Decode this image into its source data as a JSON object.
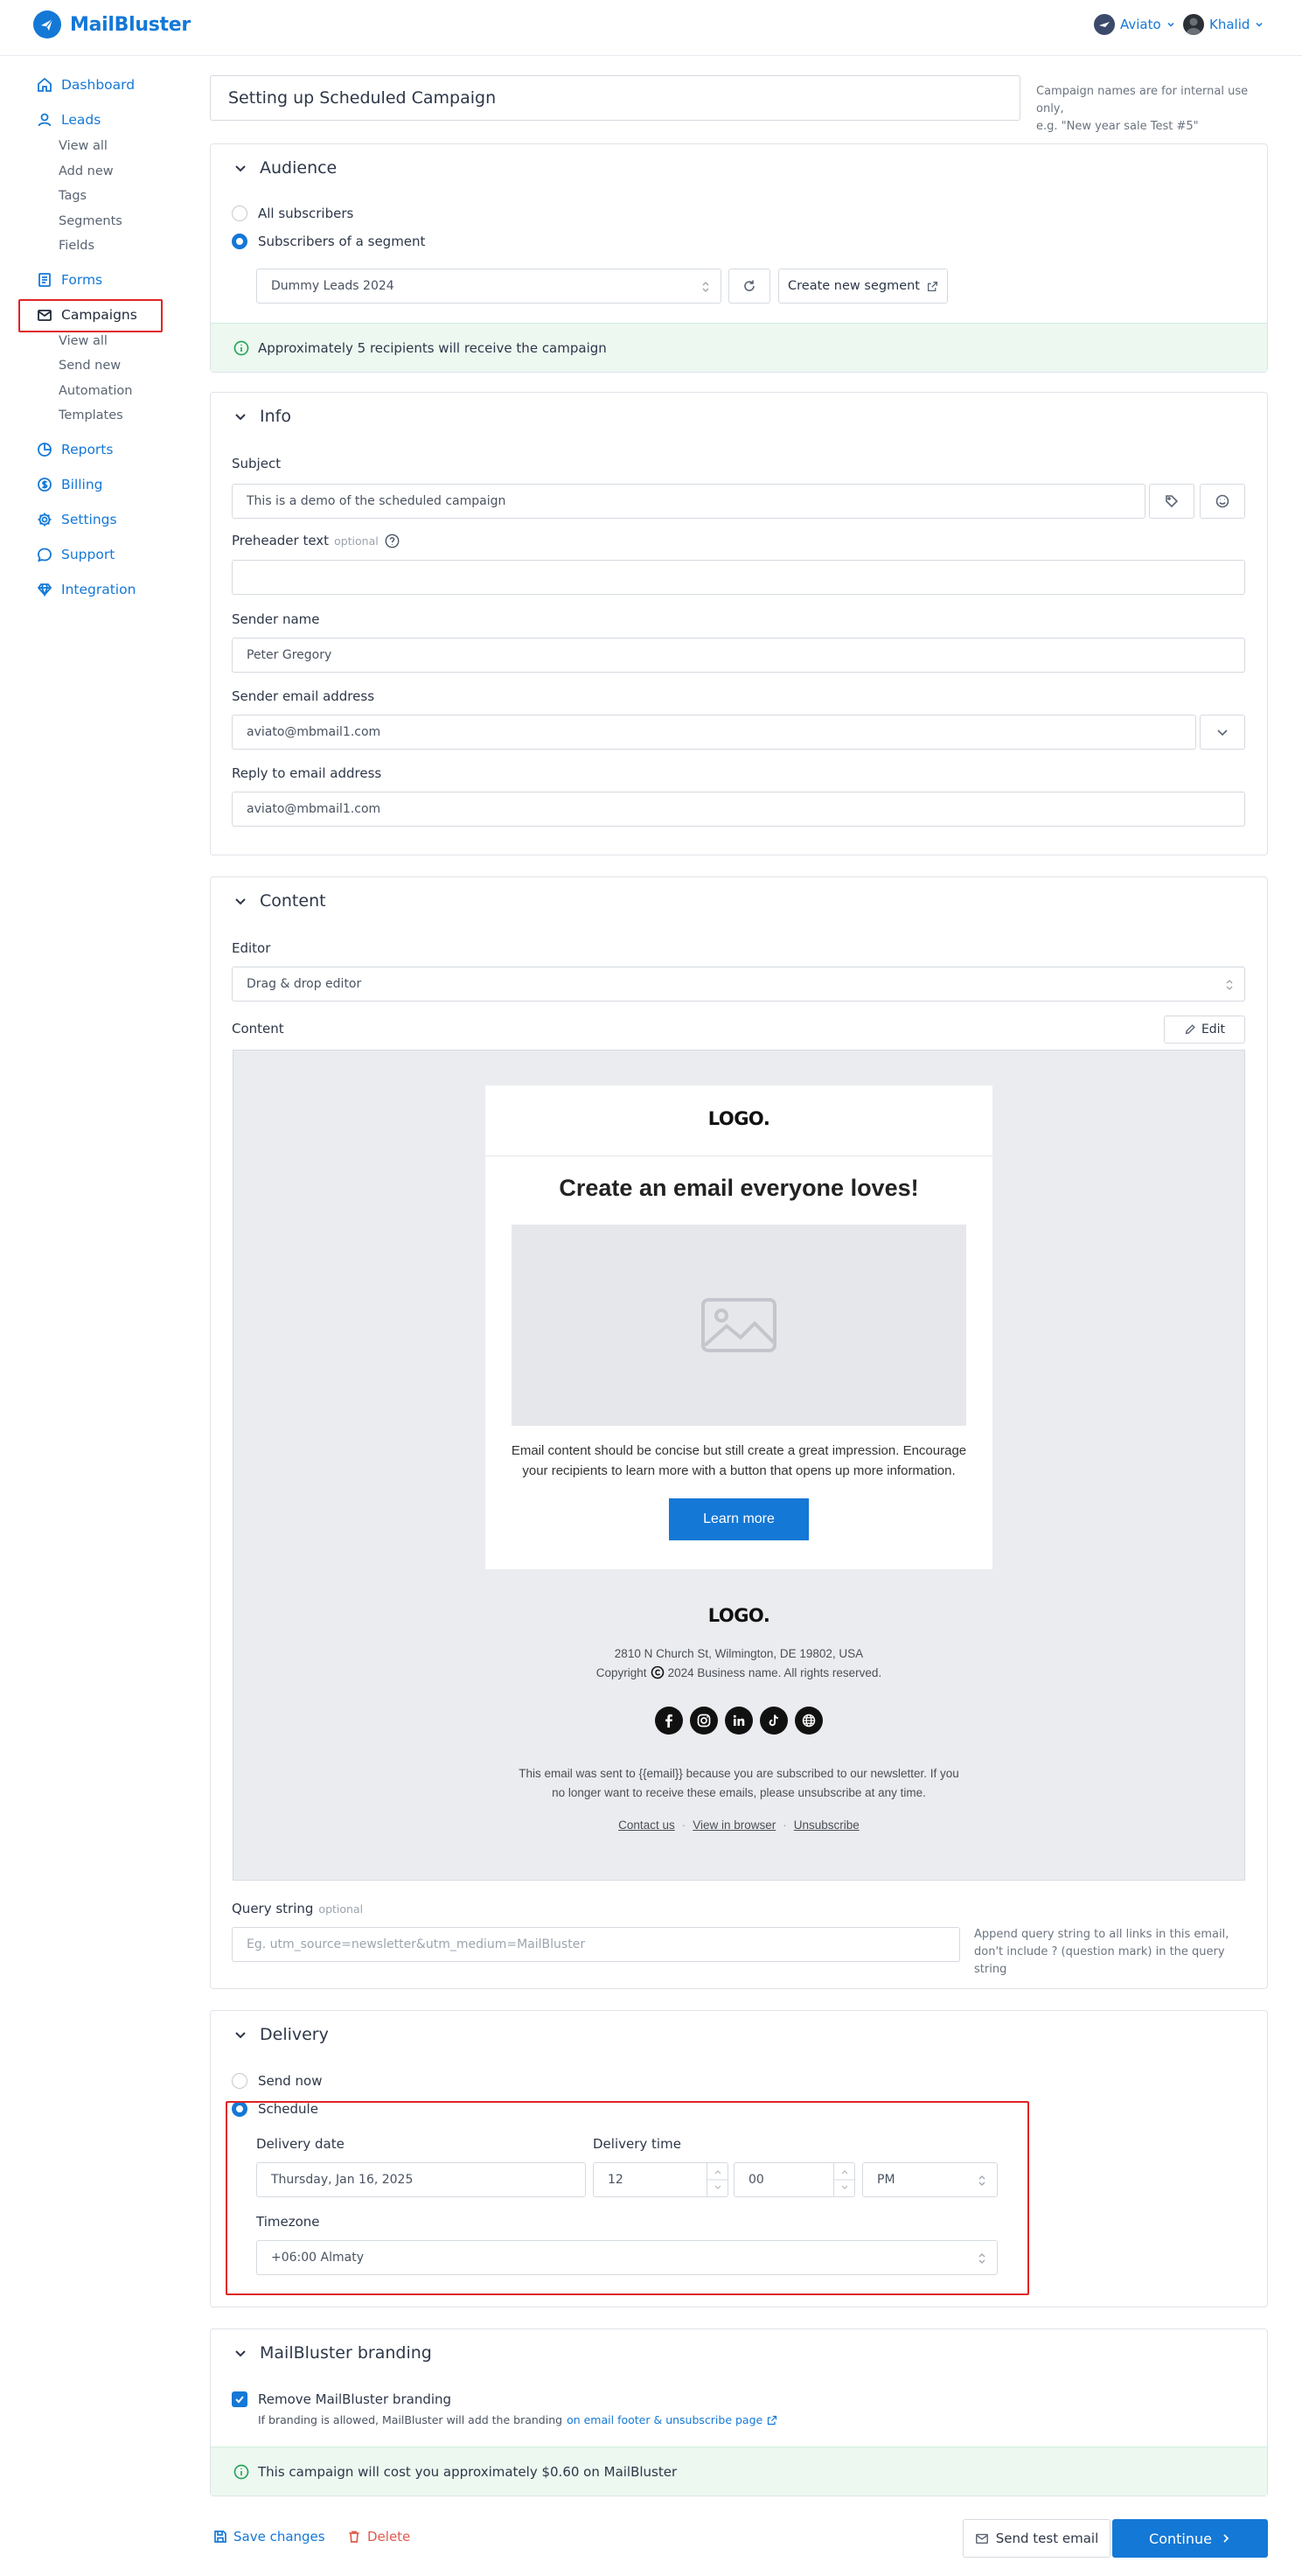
{
  "app": {
    "name": "MailBluster"
  },
  "topbar": {
    "org_name": "Aviato",
    "user_name": "Khalid"
  },
  "sidebar": {
    "items": [
      {
        "label": "Dashboard"
      },
      {
        "label": "Leads",
        "sub": [
          "View all",
          "Add new",
          "Tags",
          "Segments",
          "Fields"
        ]
      },
      {
        "label": "Forms"
      },
      {
        "label": "Campaigns",
        "sub": [
          "View all",
          "Send new",
          "Automation",
          "Templates"
        ]
      },
      {
        "label": "Reports"
      },
      {
        "label": "Billing"
      },
      {
        "label": "Settings"
      },
      {
        "label": "Support"
      },
      {
        "label": "Integration"
      }
    ]
  },
  "campaign": {
    "name_value": "Setting up Scheduled Campaign",
    "name_hint_line1": "Campaign names are for internal use only,",
    "name_hint_line2": "e.g. \"New year sale Test #5\""
  },
  "audience": {
    "title": "Audience",
    "option_all": "All subscribers",
    "option_segment": "Subscribers of a segment",
    "segment_value": "Dummy Leads 2024",
    "create_segment": "Create new segment",
    "notice": "Approximately 5 recipients will receive the campaign"
  },
  "info": {
    "title": "Info",
    "subject_label": "Subject",
    "subject_value": "This is a demo of the scheduled campaign",
    "preheader_label": "Preheader text",
    "preheader_optional": "optional",
    "preheader_value": "",
    "sender_name_label": "Sender name",
    "sender_name_value": "Peter Gregory",
    "sender_email_label": "Sender email address",
    "sender_email_value": "aviato@mbmail1.com",
    "reply_label": "Reply to email address",
    "reply_value": "aviato@mbmail1.com"
  },
  "content": {
    "title": "Content",
    "editor_label": "Editor",
    "editor_value": "Drag & drop editor",
    "content_label": "Content",
    "edit_button": "Edit",
    "query_label": "Query string",
    "query_optional": "optional",
    "query_placeholder": "Eg. utm_source=newsletter&utm_medium=MailBluster",
    "query_hint_line1": "Append query string to all links in this email,",
    "query_hint_line2": "don't include ? (question mark) in the query string"
  },
  "email_preview": {
    "logo": "LOGO.",
    "headline": "Create an email everyone loves!",
    "body_line1": "Email content should be concise but still create a great impression. Encourage",
    "body_line2": "your recipients to learn more with a button that opens up more information.",
    "cta": "Learn more",
    "footer_logo": "LOGO.",
    "address": "2810 N Church St, Wilmington, DE 19802, USA",
    "copyright_prefix": "Copyright",
    "copyright_suffix": "2024 Business name. All rights reserved.",
    "notice_line1": "This email was sent to {{email}} because you are subscribed to our newsletter. If you",
    "notice_line2": "no longer want to receive these emails, please unsubscribe at any time.",
    "links": [
      "Contact us",
      "View in browser",
      "Unsubscribe"
    ]
  },
  "delivery": {
    "title": "Delivery",
    "option_now": "Send now",
    "option_schedule": "Schedule",
    "date_label": "Delivery date",
    "date_value": "Thursday, Jan 16, 2025",
    "time_label": "Delivery time",
    "hour_value": "12",
    "minute_value": "00",
    "ampm_value": "PM",
    "tz_label": "Timezone",
    "tz_value": "+06:00 Almaty"
  },
  "branding": {
    "title": "MailBluster branding",
    "checkbox_label": "Remove MailBluster branding",
    "note_prefix": "If branding is allowed, MailBluster will add the branding",
    "note_link": "on email footer & unsubscribe page",
    "cost_notice": "This campaign will cost you approximately $0.60 on MailBluster"
  },
  "actions": {
    "save": "Save changes",
    "delete": "Delete",
    "send_test": "Send test email",
    "continue": "Continue"
  },
  "colors": {
    "accent": "#1478d6",
    "danger": "#e02424",
    "success_bg": "#edf8f1"
  }
}
